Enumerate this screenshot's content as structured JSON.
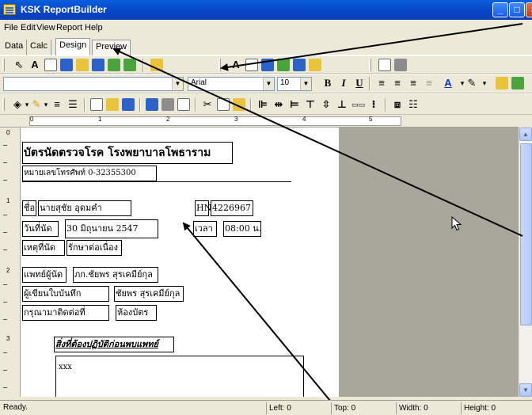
{
  "window": {
    "title": "KSK ReportBuilder"
  },
  "menu": [
    "File",
    "Edit",
    "View",
    "Report",
    "Help"
  ],
  "tabs": [
    "Data",
    "Calc",
    "Design",
    "Preview"
  ],
  "format_toolbar": {
    "font_name": "Arial",
    "font_size": "10",
    "bold": "B",
    "italic": "I",
    "underline": "U",
    "font_color": "A"
  },
  "ruler": {
    "marks": [
      "0",
      "1",
      "2",
      "3",
      "4",
      "5"
    ]
  },
  "left_ruler": {
    "marks": [
      "0",
      "1",
      "2",
      "3"
    ]
  },
  "report": {
    "title": "บัตรนัดตรวจโรค โรงพยาบาลโพธาราม",
    "phone": "หมายเลขโทรศัพท์ 0-32355300",
    "name_label": "ชื่อ",
    "name_value": "นายสุชัย อุดมคำ",
    "hn_label": "HN",
    "hn_value": "4226967",
    "date_label": "วันที่นัด",
    "date_value": "30 มิถุนายน 2547",
    "time_label": "เวลา",
    "time_value": "08:00 น.",
    "reason_label": "เหตุที่นัด",
    "reason_value": "รักษาต่อเนื่อง",
    "doctor_label": "แพทย์ผู้นัด",
    "doctor_value": "ภก.ชัยพร สุรเคมีย์กุล",
    "recorder_label": "ผู้เขียนใบบันทึก",
    "recorder_value": "ชัยพร สุรเคมีย์กุล",
    "contact_label": "กรุณามาติดต่อที่",
    "contact_value": "ห้องบัตร",
    "before_heading": "สิ่งที่ต้องปฏิบัติก่อนพบแพทย์",
    "memo_text": "xxx"
  },
  "status": {
    "state": "Ready.",
    "left": "Left: 0",
    "top": "Top: 0",
    "width": "Width: 0",
    "height": "Height: 0"
  }
}
